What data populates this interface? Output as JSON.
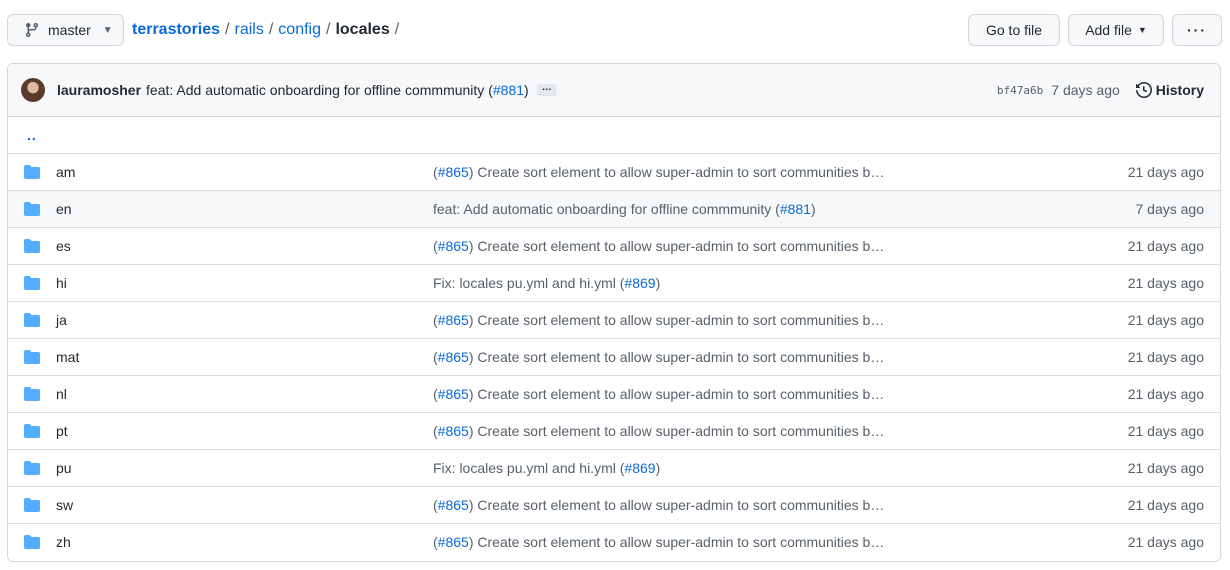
{
  "branch": {
    "name": "master"
  },
  "breadcrumb": {
    "repo": "terrastories",
    "parts": [
      "rails",
      "config"
    ],
    "current": "locales",
    "trailing_sep": "/"
  },
  "actions": {
    "go_to_file": "Go to file",
    "add_file": "Add file",
    "more": "···"
  },
  "commit": {
    "author": "lauramosher",
    "message": "feat: Add automatic onboarding for offline commmunity (",
    "pr": "#881",
    "message_end": ")",
    "ellipsis": "…",
    "sha": "bf47a6b",
    "age": "7 days ago",
    "history": "History"
  },
  "parent_dir": "..",
  "files": [
    {
      "name": "am",
      "msg_prefix": "(",
      "pr": "#865",
      "msg": ") Create sort element to allow super-admin to sort communities b…",
      "age": "21 days ago"
    },
    {
      "name": "en",
      "msg_prefix": "feat: Add automatic onboarding for offline commmunity (",
      "pr": "#881",
      "msg": ")",
      "age": "7 days ago"
    },
    {
      "name": "es",
      "msg_prefix": "(",
      "pr": "#865",
      "msg": ") Create sort element to allow super-admin to sort communities b…",
      "age": "21 days ago"
    },
    {
      "name": "hi",
      "msg_prefix": "Fix: locales pu.yml and hi.yml (",
      "pr": "#869",
      "msg": ")",
      "age": "21 days ago"
    },
    {
      "name": "ja",
      "msg_prefix": "(",
      "pr": "#865",
      "msg": ") Create sort element to allow super-admin to sort communities b…",
      "age": "21 days ago"
    },
    {
      "name": "mat",
      "msg_prefix": "(",
      "pr": "#865",
      "msg": ") Create sort element to allow super-admin to sort communities b…",
      "age": "21 days ago"
    },
    {
      "name": "nl",
      "msg_prefix": "(",
      "pr": "#865",
      "msg": ") Create sort element to allow super-admin to sort communities b…",
      "age": "21 days ago"
    },
    {
      "name": "pt",
      "msg_prefix": "(",
      "pr": "#865",
      "msg": ") Create sort element to allow super-admin to sort communities b…",
      "age": "21 days ago"
    },
    {
      "name": "pu",
      "msg_prefix": "Fix: locales pu.yml and hi.yml (",
      "pr": "#869",
      "msg": ")",
      "age": "21 days ago"
    },
    {
      "name": "sw",
      "msg_prefix": "(",
      "pr": "#865",
      "msg": ") Create sort element to allow super-admin to sort communities b…",
      "age": "21 days ago"
    },
    {
      "name": "zh",
      "msg_prefix": "(",
      "pr": "#865",
      "msg": ") Create sort element to allow super-admin to sort communities b…",
      "age": "21 days ago"
    }
  ],
  "colors": {
    "link": "#0969da",
    "folder": "#54aeff",
    "border": "#d0d7de"
  }
}
